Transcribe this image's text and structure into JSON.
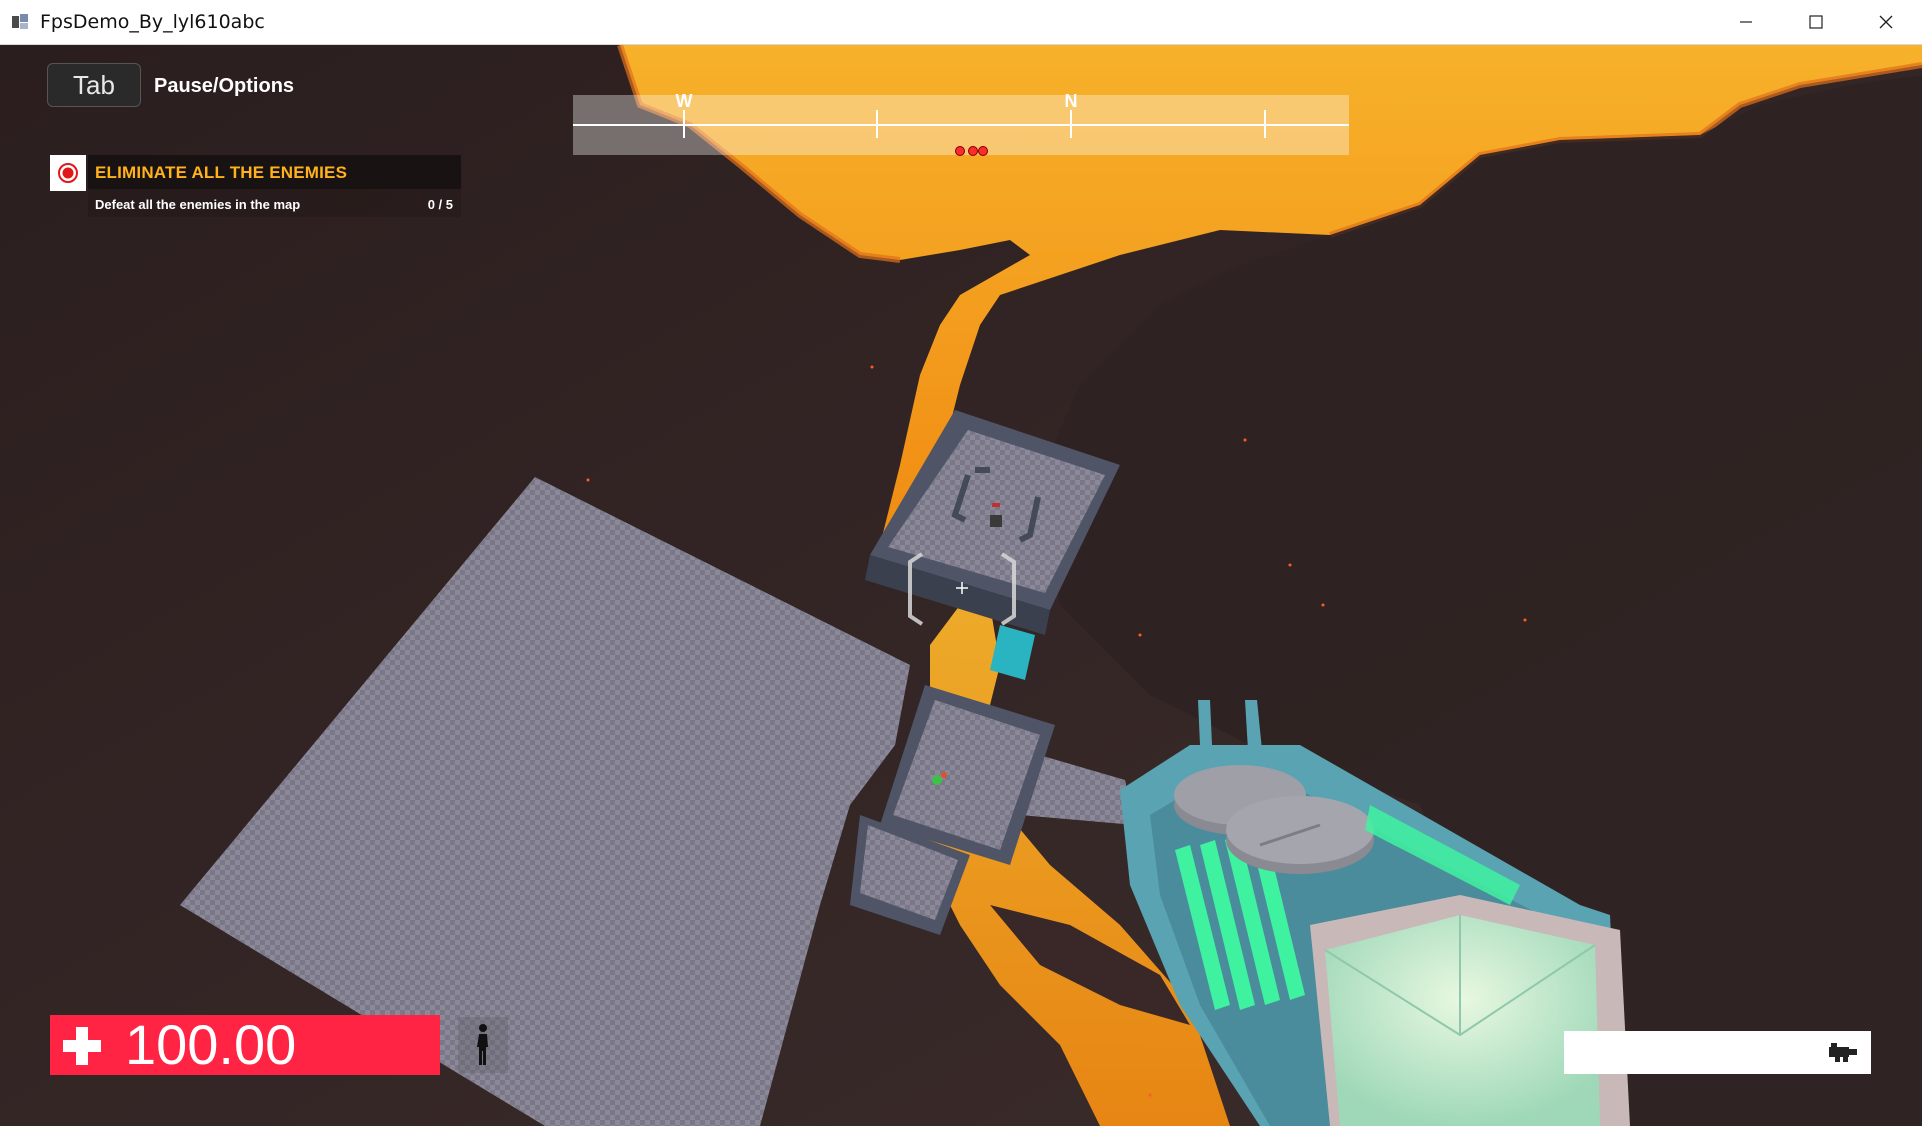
{
  "window": {
    "title": "FpsDemo_By_lyl610abc",
    "icon": "unity-app-icon",
    "controls": [
      "minimize-icon",
      "maximize-icon",
      "close-icon"
    ]
  },
  "hud": {
    "menu_key": "Tab",
    "menu_label": "Pause/Options",
    "objective": {
      "icon": "target-icon",
      "title": "ELIMINATE ALL THE ENEMIES",
      "description": "Defeat all the enemies in the map",
      "progress": "0 / 5"
    },
    "compass": {
      "labels": [
        "W",
        "N"
      ],
      "enemy_markers": 3
    },
    "health": {
      "icon": "health-cross-icon",
      "value": "100.00"
    },
    "stance": "standing-figure-icon",
    "weapon_icon": "blaster-gun-icon",
    "colors": {
      "health_bar": "#ff2443",
      "objective_title": "#ffb219",
      "enemy_marker": "#ff2a2a",
      "lava": "#f5a623",
      "weapon_glow": "#3ff2a0"
    }
  }
}
